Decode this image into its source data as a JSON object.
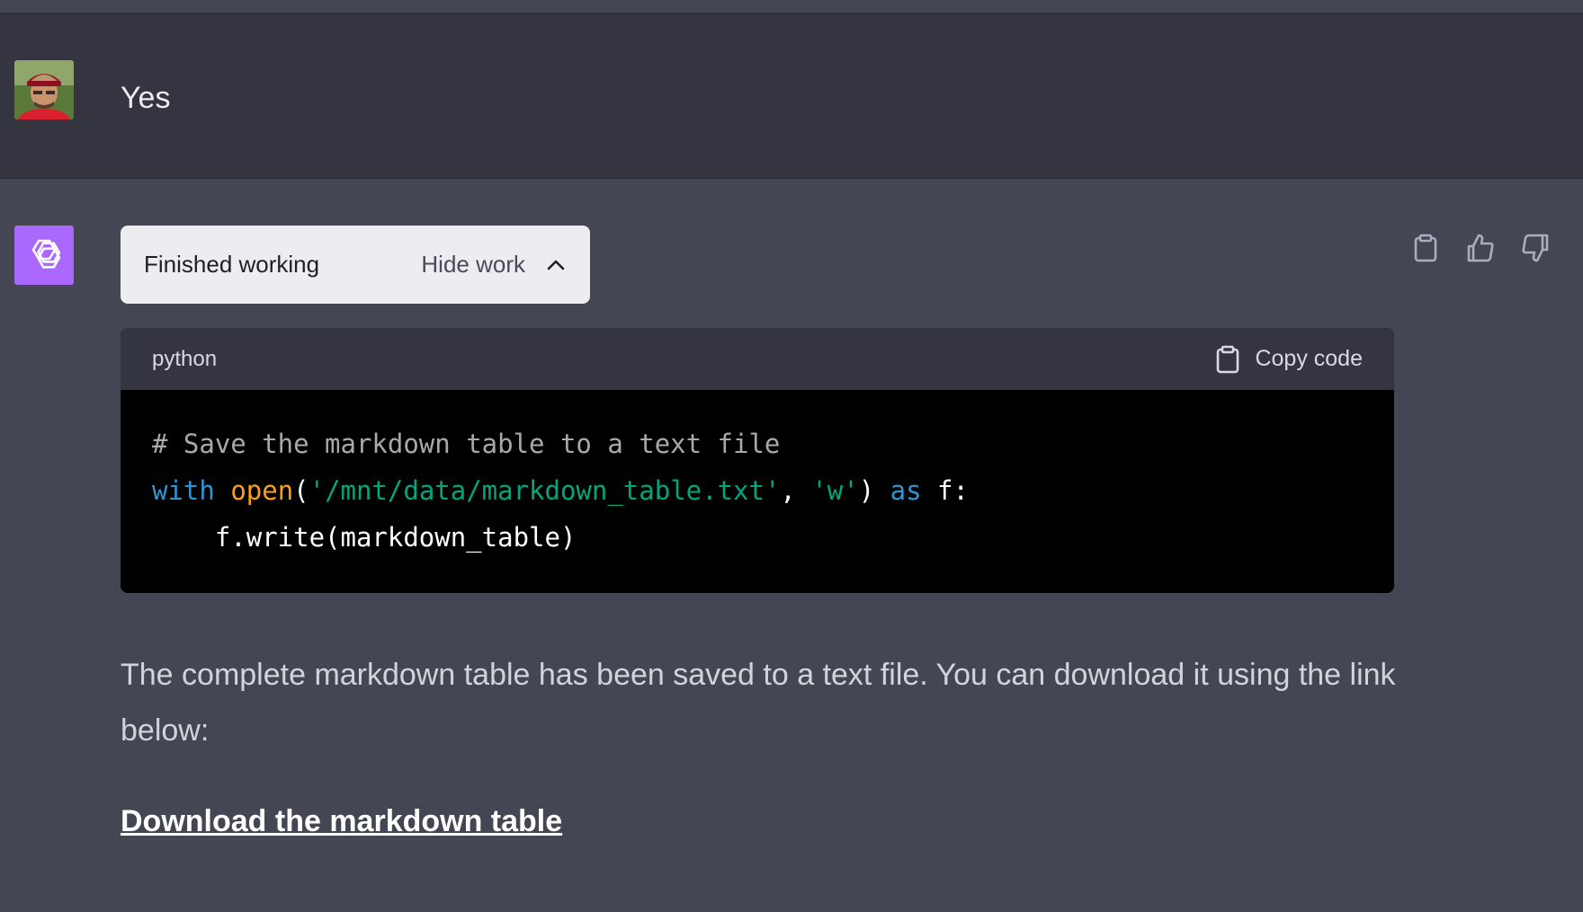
{
  "user_message": {
    "text": "Yes",
    "avatar_icon": "user-photo"
  },
  "assistant": {
    "avatar_icon": "openai-logo-icon",
    "avatar_color": "#ab68ff",
    "work_status": "Finished working",
    "work_toggle_label": "Hide work",
    "code": {
      "language": "python",
      "copy_label": "Copy code",
      "lines": [
        "# Save the markdown table to a text file",
        "with open('/mnt/data/markdown_table.txt', 'w') as f:",
        "    f.write(markdown_table)"
      ]
    },
    "response_text": "The complete markdown table has been saved to a text file. You can download it using the link below:",
    "link_text": "Download the markdown table",
    "actions": [
      "clipboard-icon",
      "thumbs-up-icon",
      "thumbs-down-icon"
    ]
  }
}
